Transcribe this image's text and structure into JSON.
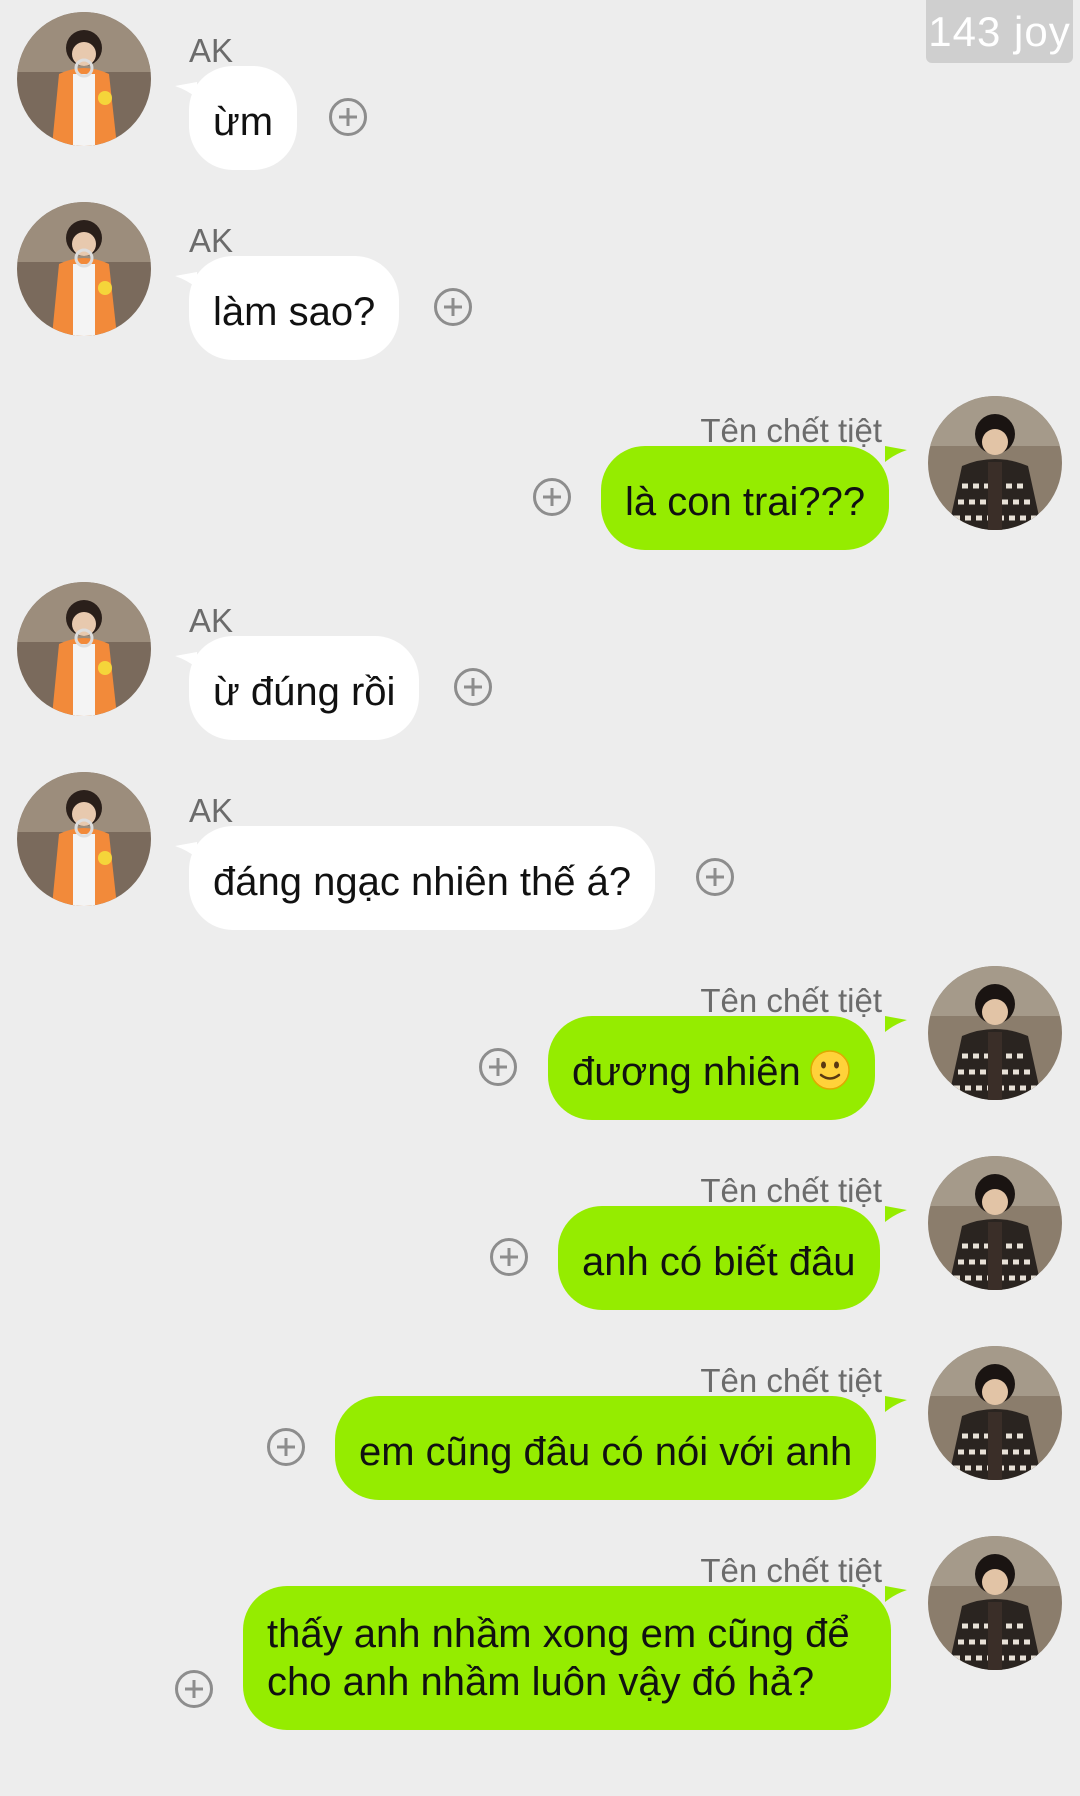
{
  "watermark": "143 joy",
  "ak_name": "AK",
  "me_name": "Tên chết tiệt",
  "messages": [
    {
      "text": "ừm"
    },
    {
      "text": "làm sao?"
    },
    {
      "text": "là con trai???"
    },
    {
      "text": "ừ đúng rồi"
    },
    {
      "text": "đáng ngạc nhiên thế á?"
    },
    {
      "text": "đương nhiên",
      "emoji": "slightly-smiling-face-icon"
    },
    {
      "text": "anh có biết đâu"
    },
    {
      "text": "em cũng đâu có nói với anh"
    },
    {
      "text": "thấy anh nhầm xong em cũng để cho anh nhầm luôn vậy đó hả?"
    }
  ],
  "colors": {
    "background": "#ededed",
    "incoming_bubble": "#ffffff",
    "outgoing_bubble": "#95ec00",
    "name_text": "#6b6b6b",
    "add_icon": "#8d8d8d"
  }
}
